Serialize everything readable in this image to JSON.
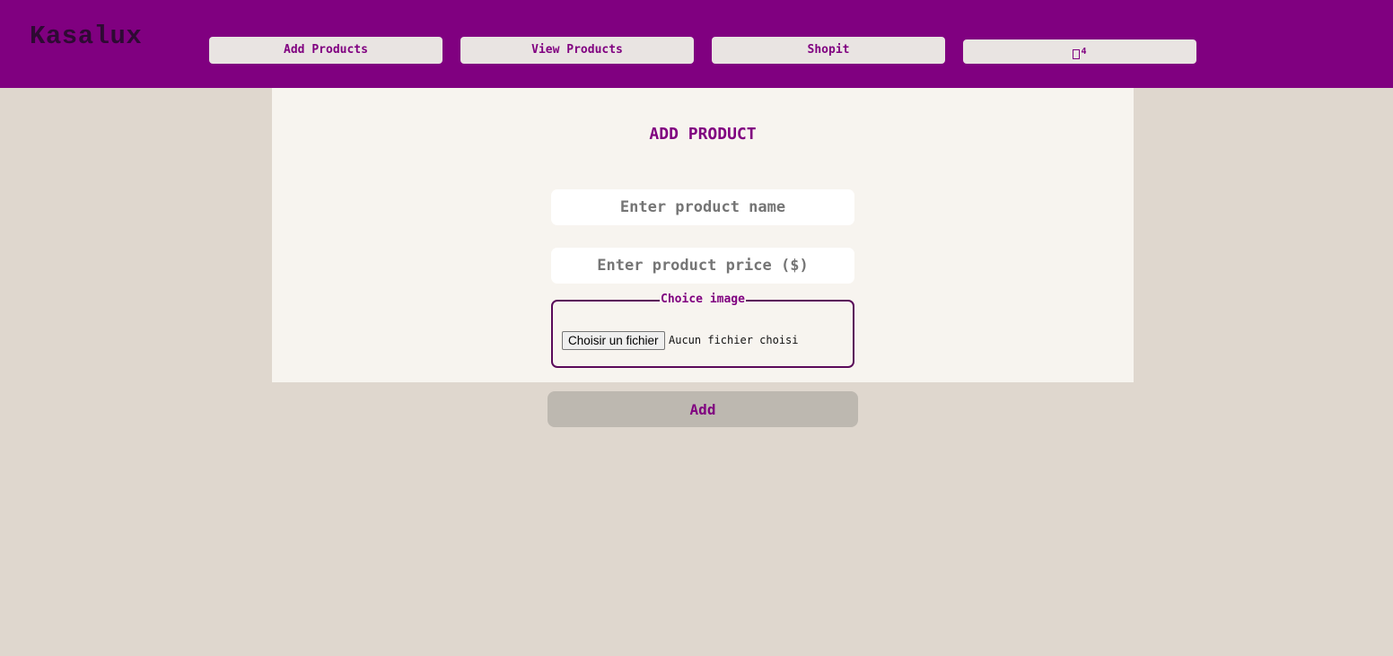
{
  "header": {
    "brand": "Kasalux",
    "nav": {
      "add_products": "Add Products",
      "view_products": "View Products",
      "shopit": "Shopit",
      "cart_count": "4"
    }
  },
  "form": {
    "title": "ADD PRODUCT",
    "name_placeholder": "Enter product name",
    "price_placeholder": "Enter product price ($)",
    "image_legend": "Choice image",
    "file_button": "Choisir un fichier",
    "file_status": "Aucun fichier choisi",
    "submit_label": "Add"
  },
  "colors": {
    "accent": "#800080",
    "background": "#dfd7ce",
    "panel": "#f7f4ef",
    "nav_button": "#e9e4e2",
    "submit_button": "#bdb8b0"
  },
  "icons": {
    "cart": "cart-icon"
  }
}
